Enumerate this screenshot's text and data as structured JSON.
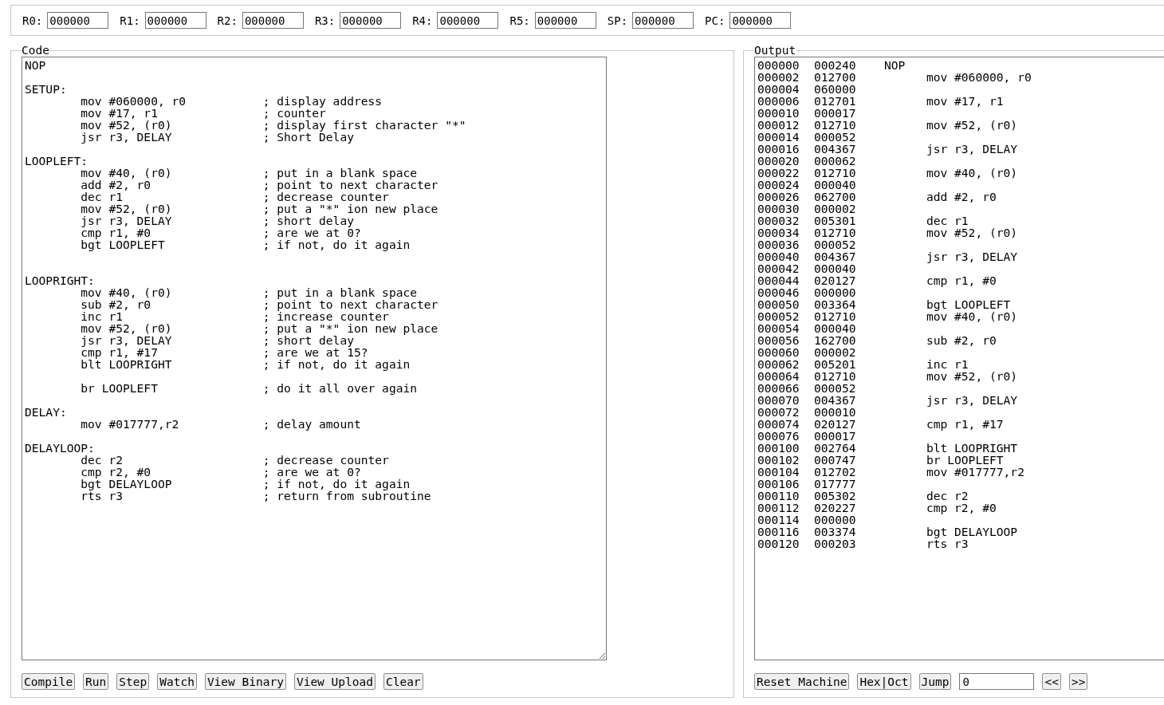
{
  "registers": [
    {
      "label": "R0:",
      "value": "000000"
    },
    {
      "label": "R1:",
      "value": "000000"
    },
    {
      "label": "R2:",
      "value": "000000"
    },
    {
      "label": "R3:",
      "value": "000000"
    },
    {
      "label": "R4:",
      "value": "000000"
    },
    {
      "label": "R5:",
      "value": "000000"
    },
    {
      "label": "SP:",
      "value": "000000"
    },
    {
      "label": "PC:",
      "value": "000000"
    }
  ],
  "code": {
    "title": "Code",
    "value": "NOP\n\nSETUP:\n        mov #060000, r0           ; display address\n        mov #17, r1               ; counter\n        mov #52, (r0)             ; display first character \"*\"\n        jsr r3, DELAY             ; Short Delay\n\nLOOPLEFT:\n        mov #40, (r0)             ; put in a blank space\n        add #2, r0                ; point to next character\n        dec r1                    ; decrease counter\n        mov #52, (r0)             ; put a \"*\" ion new place\n        jsr r3, DELAY             ; short delay\n        cmp r1, #0                ; are we at 0?\n        bgt LOOPLEFT              ; if not, do it again\n\n\nLOOPRIGHT:\n        mov #40, (r0)             ; put in a blank space\n        sub #2, r0                ; point to next character\n        inc r1                    ; increase counter\n        mov #52, (r0)             ; put a \"*\" ion new place\n        jsr r3, DELAY             ; short delay\n        cmp r1, #17               ; are we at 15?\n        blt LOOPRIGHT             ; if not, do it again\n\n        br LOOPLEFT               ; do it all over again\n\nDELAY:\n        mov #017777,r2            ; delay amount\n\nDELAYLOOP:\n        dec r2                    ; decrease counter\n        cmp r2, #0                ; are we at 0?\n        bgt DELAYLOOP             ; if not, do it again\n        rts r3                    ; return from subroutine",
    "buttons": [
      "Compile",
      "Run",
      "Step",
      "Watch",
      "View Binary",
      "View Upload",
      "Clear"
    ]
  },
  "output": {
    "title": "Output",
    "rows": [
      {
        "address": "000000",
        "word": "000240",
        "column_3": "NOP"
      },
      {
        "address": "000002",
        "word": "012700",
        "instruction": "mov #060000, r0"
      },
      {
        "address": "000004",
        "word": "060000"
      },
      {
        "address": "000006",
        "word": "012701",
        "instruction": "mov #17, r1"
      },
      {
        "address": "000010",
        "word": "000017"
      },
      {
        "address": "000012",
        "word": "012710",
        "instruction": "mov #52, (r0)"
      },
      {
        "address": "000014",
        "word": "000052"
      },
      {
        "address": "000016",
        "word": "004367",
        "instruction": "jsr r3, DELAY"
      },
      {
        "address": "000020",
        "word": "000062"
      },
      {
        "address": "000022",
        "word": "012710",
        "instruction": "mov #40, (r0)"
      },
      {
        "address": "000024",
        "word": "000040"
      },
      {
        "address": "000026",
        "word": "062700",
        "instruction": "add #2, r0"
      },
      {
        "address": "000030",
        "word": "000002"
      },
      {
        "address": "000032",
        "word": "005301",
        "instruction": "dec r1"
      },
      {
        "address": "000034",
        "word": "012710",
        "instruction": "mov #52, (r0)"
      },
      {
        "address": "000036",
        "word": "000052"
      },
      {
        "address": "000040",
        "word": "004367",
        "instruction": "jsr r3, DELAY"
      },
      {
        "address": "000042",
        "word": "000040"
      },
      {
        "address": "000044",
        "word": "020127",
        "instruction": "cmp r1, #0"
      },
      {
        "address": "000046",
        "word": "000000"
      },
      {
        "address": "000050",
        "word": "003364",
        "instruction": "bgt LOOPLEFT"
      },
      {
        "address": "000052",
        "word": "012710",
        "instruction": "mov #40, (r0)"
      },
      {
        "address": "000054",
        "word": "000040"
      },
      {
        "address": "000056",
        "word": "162700",
        "instruction": "sub #2, r0"
      },
      {
        "address": "000060",
        "word": "000002"
      },
      {
        "address": "000062",
        "word": "005201",
        "instruction": "inc r1"
      },
      {
        "address": "000064",
        "word": "012710",
        "instruction": "mov #52, (r0)"
      },
      {
        "address": "000066",
        "word": "000052"
      },
      {
        "address": "000070",
        "word": "004367",
        "instruction": "jsr r3, DELAY"
      },
      {
        "address": "000072",
        "word": "000010"
      },
      {
        "address": "000074",
        "word": "020127",
        "instruction": "cmp r1, #17"
      },
      {
        "address": "000076",
        "word": "000017"
      },
      {
        "address": "000100",
        "word": "002764",
        "instruction": "blt LOOPRIGHT"
      },
      {
        "address": "000102",
        "word": "000747",
        "instruction": "br LOOPLEFT"
      },
      {
        "address": "000104",
        "word": "012702",
        "instruction": "mov #017777,r2"
      },
      {
        "address": "000106",
        "word": "017777"
      },
      {
        "address": "000110",
        "word": "005302",
        "instruction": "dec r2"
      },
      {
        "address": "000112",
        "word": "020227",
        "instruction": "cmp r2, #0"
      },
      {
        "address": "000114",
        "word": "000000"
      },
      {
        "address": "000116",
        "word": "003374",
        "instruction": "bgt DELAYLOOP"
      },
      {
        "address": "000120",
        "word": "000203",
        "instruction": "rts r3"
      }
    ],
    "reset_button": "Reset Machine",
    "hex_oct_button": "Hex|Oct",
    "jump_button": "Jump",
    "jump_field": {
      "value": "0"
    },
    "prev_button": "<<",
    "next_button": ">>"
  }
}
